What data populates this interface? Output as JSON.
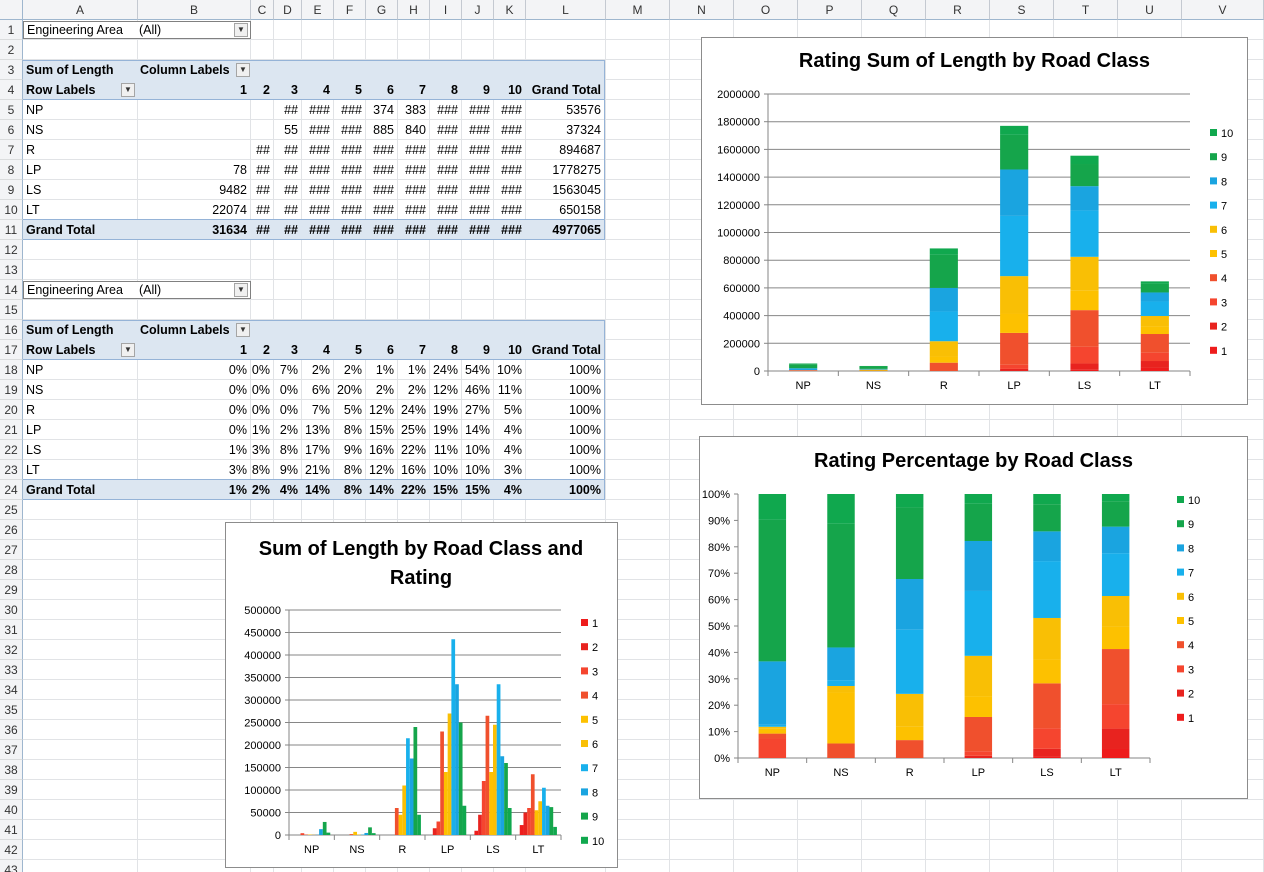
{
  "columns": [
    "A",
    "B",
    "C",
    "D",
    "E",
    "F",
    "G",
    "H",
    "I",
    "J",
    "K",
    "L",
    "M",
    "N",
    "O",
    "P",
    "Q",
    "R",
    "S",
    "T",
    "U",
    "V"
  ],
  "rows": [
    "1",
    "2",
    "3",
    "4",
    "5",
    "6",
    "7",
    "8",
    "9",
    "10",
    "11",
    "12",
    "13",
    "14",
    "15",
    "16",
    "17",
    "18",
    "19",
    "20",
    "21",
    "22",
    "23",
    "24",
    "25",
    "26",
    "27",
    "28",
    "29",
    "30",
    "31",
    "32",
    "33",
    "34",
    "35",
    "36",
    "37",
    "38",
    "39",
    "40",
    "41",
    "42",
    "43"
  ],
  "pivot1": {
    "filter_label": "Engineering Area",
    "filter_value": "(All)",
    "values_label": "Sum of Length",
    "column_labels": "Column Labels",
    "row_labels": "Row Labels",
    "headers": [
      "1",
      "2",
      "3",
      "4",
      "5",
      "6",
      "7",
      "8",
      "9",
      "10",
      "Grand Total"
    ],
    "rows": [
      {
        "label": "NP",
        "cells": [
          "",
          "",
          "##",
          "###",
          "###",
          "374",
          "383",
          "###",
          "###",
          "###",
          "53576"
        ]
      },
      {
        "label": "NS",
        "cells": [
          "",
          "",
          "55",
          "###",
          "###",
          "885",
          "840",
          "###",
          "###",
          "###",
          "37324"
        ]
      },
      {
        "label": "R",
        "cells": [
          "",
          "##",
          "##",
          "###",
          "###",
          "###",
          "###",
          "###",
          "###",
          "###",
          "894687"
        ]
      },
      {
        "label": "LP",
        "cells": [
          "78",
          "##",
          "##",
          "###",
          "###",
          "###",
          "###",
          "###",
          "###",
          "###",
          "1778275"
        ]
      },
      {
        "label": "LS",
        "cells": [
          "9482",
          "##",
          "##",
          "###",
          "###",
          "###",
          "###",
          "###",
          "###",
          "###",
          "1563045"
        ]
      },
      {
        "label": "LT",
        "cells": [
          "22074",
          "##",
          "##",
          "###",
          "###",
          "###",
          "###",
          "###",
          "###",
          "###",
          "650158"
        ]
      }
    ],
    "total": {
      "label": "Grand Total",
      "cells": [
        "31634",
        "##",
        "##",
        "###",
        "###",
        "###",
        "###",
        "###",
        "###",
        "###",
        "4977065"
      ]
    }
  },
  "pivot2": {
    "filter_label": "Engineering Area",
    "filter_value": "(All)",
    "values_label": "Sum of Length",
    "column_labels": "Column Labels",
    "row_labels": "Row Labels",
    "headers": [
      "1",
      "2",
      "3",
      "4",
      "5",
      "6",
      "7",
      "8",
      "9",
      "10",
      "Grand Total"
    ],
    "rows": [
      {
        "label": "NP",
        "cells": [
          "0%",
          "0%",
          "7%",
          "2%",
          "2%",
          "1%",
          "1%",
          "24%",
          "54%",
          "10%",
          "100%"
        ]
      },
      {
        "label": "NS",
        "cells": [
          "0%",
          "0%",
          "0%",
          "6%",
          "20%",
          "2%",
          "2%",
          "12%",
          "46%",
          "11%",
          "100%"
        ]
      },
      {
        "label": "R",
        "cells": [
          "0%",
          "0%",
          "0%",
          "7%",
          "5%",
          "12%",
          "24%",
          "19%",
          "27%",
          "5%",
          "100%"
        ]
      },
      {
        "label": "LP",
        "cells": [
          "0%",
          "1%",
          "2%",
          "13%",
          "8%",
          "15%",
          "25%",
          "19%",
          "14%",
          "4%",
          "100%"
        ]
      },
      {
        "label": "LS",
        "cells": [
          "1%",
          "3%",
          "8%",
          "17%",
          "9%",
          "16%",
          "22%",
          "11%",
          "10%",
          "4%",
          "100%"
        ]
      },
      {
        "label": "LT",
        "cells": [
          "3%",
          "8%",
          "9%",
          "21%",
          "8%",
          "12%",
          "16%",
          "10%",
          "10%",
          "3%",
          "100%"
        ]
      }
    ],
    "total": {
      "label": "Grand Total",
      "cells": [
        "1%",
        "2%",
        "4%",
        "14%",
        "8%",
        "14%",
        "22%",
        "15%",
        "15%",
        "4%",
        "100%"
      ]
    }
  },
  "series_colors": {
    "1": "#ee1c1c",
    "2": "#e8231f",
    "3": "#f5452f",
    "4": "#f0502d",
    "5": "#fdc100",
    "6": "#f9bf05",
    "7": "#18b0ec",
    "8": "#1aa4e0",
    "9": "#15a54b",
    "10": "#10a84e"
  },
  "chart_data": [
    {
      "type": "bar",
      "stacked": true,
      "title": "Rating Sum of Length by Road Class",
      "categories": [
        "NP",
        "NS",
        "R",
        "LP",
        "LS",
        "LT"
      ],
      "ylim": [
        0,
        2000000
      ],
      "yticks": [
        "0",
        "200000",
        "400000",
        "600000",
        "800000",
        "1000000",
        "1200000",
        "1400000",
        "1600000",
        "1800000",
        "2000000"
      ],
      "legend": [
        "10",
        "9",
        "8",
        "7",
        "6",
        "5",
        "4",
        "3",
        "2",
        "1"
      ],
      "legend_position": "right",
      "series": [
        {
          "name": "1",
          "values": [
            0,
            0,
            0,
            0,
            9482,
            22074
          ]
        },
        {
          "name": "2",
          "values": [
            0,
            0,
            0,
            15000,
            45000,
            50000
          ]
        },
        {
          "name": "3",
          "values": [
            4000,
            0,
            0,
            30000,
            120000,
            60000
          ]
        },
        {
          "name": "4",
          "values": [
            1000,
            2000,
            60000,
            230000,
            265000,
            135000
          ]
        },
        {
          "name": "5",
          "values": [
            1000,
            7000,
            45000,
            140000,
            140000,
            55000
          ]
        },
        {
          "name": "6",
          "values": [
            400,
            900,
            110000,
            270000,
            245000,
            75000
          ]
        },
        {
          "name": "7",
          "values": [
            400,
            800,
            215000,
            435000,
            335000,
            105000
          ]
        },
        {
          "name": "8",
          "values": [
            13000,
            4500,
            170000,
            335000,
            175000,
            65000
          ]
        },
        {
          "name": "9",
          "values": [
            29000,
            17000,
            240000,
            250000,
            160000,
            62000
          ]
        },
        {
          "name": "10",
          "values": [
            5300,
            4100,
            45000,
            65000,
            60000,
            18000
          ]
        }
      ]
    },
    {
      "type": "bar",
      "stacked": true,
      "percent": true,
      "title": "Rating Percentage by Road Class",
      "categories": [
        "NP",
        "NS",
        "R",
        "LP",
        "LS",
        "LT"
      ],
      "ylim": [
        0,
        100
      ],
      "yticks": [
        "0%",
        "10%",
        "20%",
        "30%",
        "40%",
        "50%",
        "60%",
        "70%",
        "80%",
        "90%",
        "100%"
      ],
      "legend": [
        "10",
        "9",
        "8",
        "7",
        "6",
        "5",
        "4",
        "3",
        "2",
        "1"
      ],
      "legend_position": "right"
    },
    {
      "type": "bar",
      "title": "Sum of Length by Road Class and Rating",
      "categories": [
        "NP",
        "NS",
        "R",
        "LP",
        "LS",
        "LT"
      ],
      "ylim": [
        0,
        500000
      ],
      "yticks": [
        "0",
        "50000",
        "100000",
        "150000",
        "200000",
        "250000",
        "300000",
        "350000",
        "400000",
        "450000",
        "500000"
      ],
      "legend": [
        "1",
        "2",
        "3",
        "4",
        "5",
        "6",
        "7",
        "8",
        "9",
        "10"
      ],
      "legend_position": "right"
    }
  ]
}
